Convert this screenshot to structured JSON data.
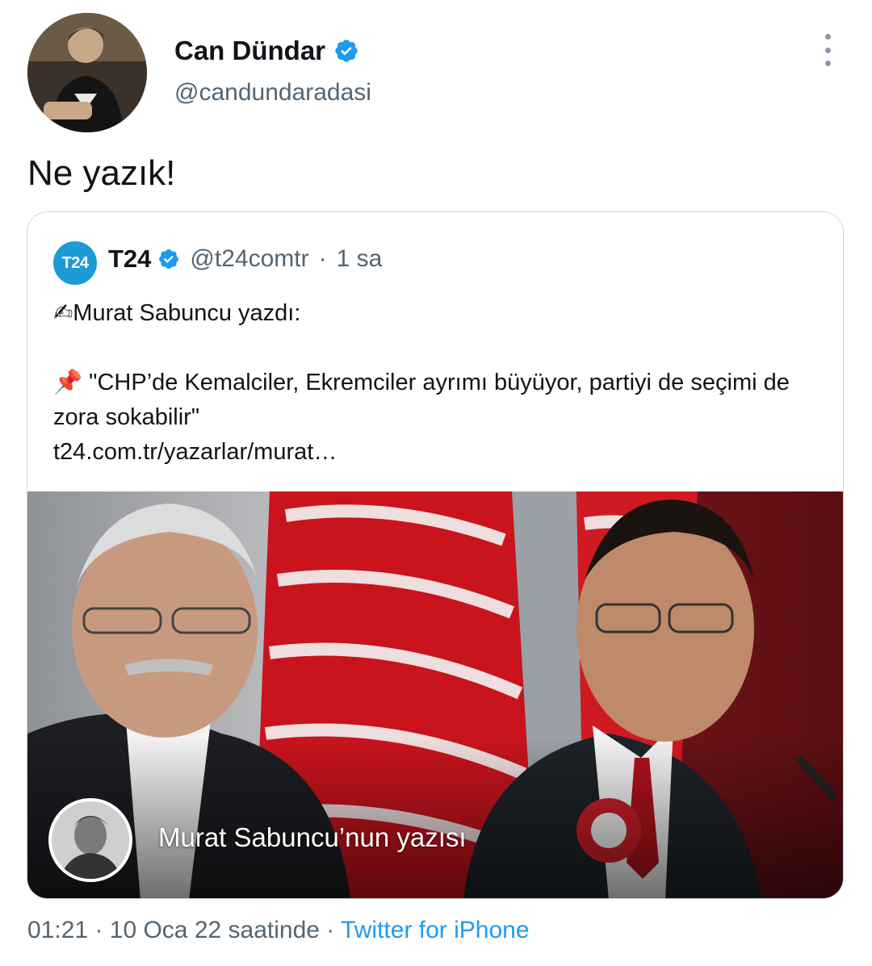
{
  "author": {
    "name": "Can Dündar",
    "handle": "@candundaradasi",
    "verified": true
  },
  "tweet": {
    "text": "Ne yazık!"
  },
  "quote": {
    "logo_text": "T24",
    "name": "T24",
    "handle": "@t24comtr",
    "separator": "·",
    "time": "1 sa",
    "line1": "✍Murat Sabuncu yazdı:",
    "line2": "📌 \"CHP’de Kemalciler, Ekremciler ayrımı büyüyor, partiyi de seçimi de zora sokabilir\"",
    "link": "t24.com.tr/yazarlar/murat…",
    "media_caption": "Murat Sabuncu’nun yazısı"
  },
  "footer": {
    "time": "01:21",
    "dot1": "·",
    "date": "10 Oca 22 saatinde",
    "dot2": "·",
    "source": "Twitter for iPhone"
  },
  "colors": {
    "verified": "#1d9bf0",
    "link": "#1d9bf0",
    "muted": "#536471",
    "logo": "#1d9bd6"
  },
  "icons": {
    "verified": "verified-badge-icon",
    "more": "more-options-icon"
  }
}
